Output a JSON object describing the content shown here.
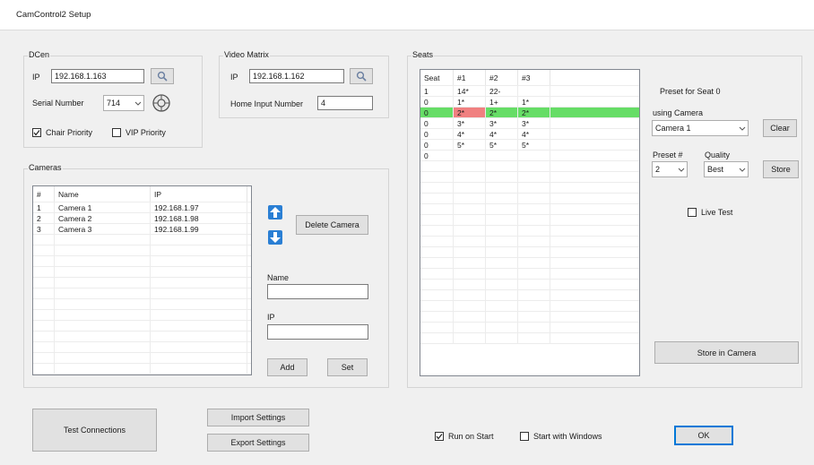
{
  "window": {
    "title": "CamControl2 Setup"
  },
  "dcen": {
    "group_label": "DCen",
    "ip_label": "IP",
    "ip_value": "192.168.1.163",
    "serial_label": "Serial Number",
    "serial_value": "714",
    "chair_priority_label": "Chair Priority",
    "chair_priority_checked": true,
    "vip_priority_label": "VIP Priority",
    "vip_priority_checked": false
  },
  "video_matrix": {
    "group_label": "Video Matrix",
    "ip_label": "IP",
    "ip_value": "192.168.1.162",
    "home_input_label": "Home Input Number",
    "home_input_value": "4"
  },
  "cameras": {
    "group_label": "Cameras",
    "columns": [
      "#",
      "Name",
      "IP"
    ],
    "rows": [
      [
        "1",
        "Camera 1",
        "192.168.1.97"
      ],
      [
        "2",
        "Camera 2",
        "192.168.1.98"
      ],
      [
        "3",
        "Camera 3",
        "192.168.1.99"
      ]
    ],
    "delete_label": "Delete Camera",
    "name_label": "Name",
    "name_value": "",
    "ip_label": "IP",
    "ip_value": "",
    "add_label": "Add",
    "set_label": "Set"
  },
  "seats": {
    "group_label": "Seats",
    "columns": [
      "Seat",
      "#1",
      "#2",
      "#3"
    ],
    "rows": [
      [
        "1",
        "14*",
        "22-",
        ""
      ],
      [
        "0",
        "1*",
        "1+",
        "1*"
      ],
      [
        "0",
        "2*",
        "2*",
        "2*"
      ],
      [
        "0",
        "3*",
        "3*",
        "3*"
      ],
      [
        "0",
        "4*",
        "4*",
        "4*"
      ],
      [
        "0",
        "5*",
        "5*",
        "5*"
      ],
      [
        "0",
        "",
        "",
        ""
      ]
    ],
    "selected_row": 2,
    "highlight_cell": [
      2,
      1
    ],
    "preset_for_label": "Preset for Seat 0",
    "using_camera_label": "using Camera",
    "camera_value": "Camera 1",
    "clear_label": "Clear",
    "preset_label": "Preset #",
    "preset_value": "2",
    "quality_label": "Quality",
    "quality_value": "Best",
    "store_label": "Store",
    "live_test_label": "Live Test",
    "live_test_checked": false,
    "store_in_camera_label": "Store in Camera"
  },
  "footer": {
    "test_connections_label": "Test Connections",
    "import_label": "Import Settings",
    "export_label": "Export Settings",
    "run_on_start_label": "Run on Start",
    "run_on_start_checked": true,
    "start_with_windows_label": "Start with Windows",
    "start_with_windows_checked": false,
    "ok_label": "OK"
  },
  "colors": {
    "selected_row": "#66dd66",
    "highlight_cell": "#f08080",
    "arrow_blue": "#2a7fd4",
    "focus_border": "#0078d7"
  }
}
